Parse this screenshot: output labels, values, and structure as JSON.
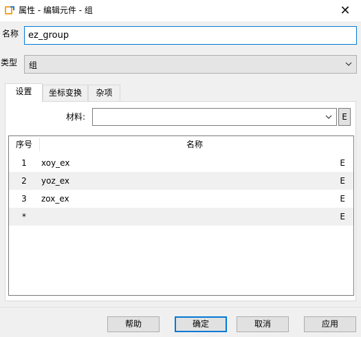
{
  "window": {
    "title": "属性 - 编辑元件 - 组",
    "close_glyph": "✕",
    "icon": "app-icon"
  },
  "form": {
    "name_label": "名称",
    "name_value": "ez_group",
    "type_label": "类型",
    "type_value": "组"
  },
  "tabs": [
    {
      "label": "设置",
      "active": true
    },
    {
      "label": "坐标变换",
      "active": false
    },
    {
      "label": "杂项",
      "active": false
    }
  ],
  "settings": {
    "material_label": "材料:",
    "material_value": "",
    "material_edit_label": "E",
    "table": {
      "headers": [
        "序号",
        "名称"
      ],
      "rows": [
        {
          "index": "1",
          "name": "xoy_ex",
          "edit": "E"
        },
        {
          "index": "2",
          "name": "yoz_ex",
          "edit": "E"
        },
        {
          "index": "3",
          "name": "zox_ex",
          "edit": "E"
        },
        {
          "index": "*",
          "name": "",
          "edit": "E"
        }
      ]
    }
  },
  "buttons": {
    "help": "帮助",
    "ok": "确定",
    "cancel": "取消",
    "apply": "应用"
  }
}
